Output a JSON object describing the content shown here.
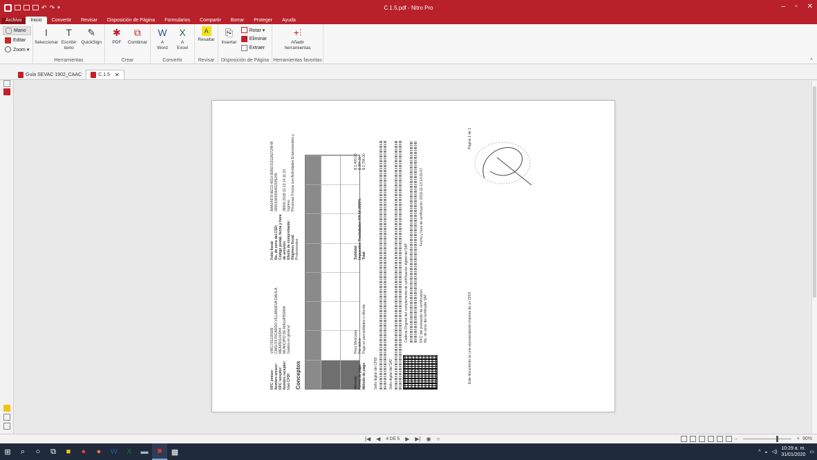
{
  "window": {
    "title": "C.1.5.pdf - Nitro Pro"
  },
  "menu": {
    "tabs": [
      "Archivo",
      "Inicio",
      "Convertir",
      "Revisar",
      "Disposición de Página",
      "Formularios",
      "Compartir",
      "Borrar",
      "Proteger",
      "Ayuda"
    ],
    "active": "Inicio"
  },
  "ribbon": {
    "mano": "Mano",
    "editar": "Editar",
    "zoom": "Zoom ▾",
    "seleccionar": "Seleccionar",
    "escribir": "Escribir texto",
    "quicksign": "QuickSign",
    "herramientas": "Herramientas",
    "pdf": "PDF",
    "combinar": "Combinar",
    "crear": "Crear",
    "a_word_1": "A",
    "a_word_2": "Word",
    "a_excel_1": "A",
    "a_excel_2": "Excel",
    "convertir": "Convertir",
    "resaltar": "Resaltar",
    "revisar": "Revisar",
    "insertar": "Insertar",
    "rotar": "Rotar ▾",
    "eliminar": "Eliminar",
    "extraer": "Extraer",
    "disposicion": "Disposición de Página",
    "anadir_1": "Añadir",
    "anadir_2": "herramientas",
    "favoritas": "Herramientas favoritas"
  },
  "doctabs": [
    {
      "label": "Guía SEVAC 1902_CAAC"
    },
    {
      "label": "C.1.5",
      "close": "✕"
    }
  ],
  "document": {
    "emisor": [
      {
        "k": "RFC emisor:",
        "v": "VIRC701229S99"
      },
      {
        "k": "Nombre emisor:",
        "v": "CARLOS RICARDO VILLANUEVA DAVILA"
      },
      {
        "k": "RFC receptor:",
        "v": "MEA850101SH4"
      },
      {
        "k": "Nombre receptor:",
        "v": "MUNICIPIO DE MALVATERRA"
      },
      {
        "k": "Uso CFDI:",
        "v": "Gastos en general"
      }
    ],
    "fiscal": [
      {
        "k": "Folio fiscal:",
        "v": "AAA14978-6EC0-4610-9D6D-D211A2724F4F"
      },
      {
        "k": "No. de serie del CSD:",
        "v": "00001000000402305248"
      },
      {
        "k": "Código postal, fecha y hora de emisión:",
        "v": "38600 2018-11-13 14:11:33"
      },
      {
        "k": "Efecto de comprobante:",
        "v": "Ingreso"
      },
      {
        "k": "Régimen fiscal:",
        "v": "Personas Físicas con Actividades Empresariales y Profesionales"
      }
    ],
    "conceptos": "Conceptos",
    "pago": [
      {
        "k": "Moneda:",
        "v": "Peso Mexicano"
      },
      {
        "k": "Forma de pago:",
        "v": "Por definir"
      },
      {
        "k": "Método de pago:",
        "v": "Pago en parcialidades o diferido"
      }
    ],
    "totales": [
      {
        "k": "Subtotal",
        "v": "$ 2,400.00"
      },
      {
        "k": "Impuestos Trasladados  IVA  16.0000%",
        "v": "$ 384.00"
      },
      {
        "k": "Total",
        "v": "$ 2,784.00"
      }
    ],
    "sello_cfdi": "Sello digital del CFDI:",
    "sello_sat": "Sello digital del SAT:",
    "cadena": "Cadena Original del complemento de certificación digital del SAT:",
    "rfc_prov": "RFC del proveedor de certificación:",
    "no_serie_sat": "No. de serie del certificado SAT",
    "fecha_cert": "Fecha y hora de certificación:",
    "fecha_cert_v": "2018-11-13 14:15:07",
    "leyenda": "Este documento es una representación impresa de un CFDI",
    "pagina": "Página 1 de 1"
  },
  "status": {
    "page": "4 DE 5",
    "zoom": "90%"
  },
  "taskbar": {
    "time": "10:29 a. m.",
    "date": "31/01/2020"
  }
}
